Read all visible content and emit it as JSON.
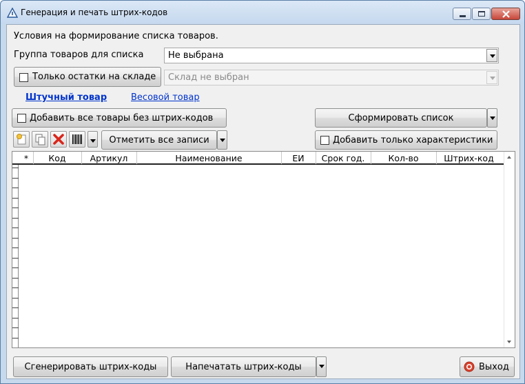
{
  "window": {
    "title": "Генерация и печать штрих-кодов"
  },
  "filters": {
    "conditions_label": "Условия на формирование списка товаров.",
    "group_label": "Группа товаров для списка",
    "group_value": "Не выбрана",
    "stock_only_label": "Только остатки на складе",
    "stock_only_checked": false,
    "warehouse_placeholder": "Склад не выбран"
  },
  "tabs": {
    "piece": "Штучный товар",
    "weight": "Весовой товар",
    "active": "piece"
  },
  "options": {
    "add_without_barcodes_label": "Добавить все товары без штрих-кодов",
    "add_without_barcodes_checked": false,
    "form_list_label": "Сформировать список",
    "mark_all_label": "Отметить все записи",
    "add_characteristics_label": "Добавить только характеристики",
    "add_characteristics_checked": false
  },
  "toolbar": {
    "icons": [
      "new-record-icon",
      "copy-record-icon",
      "delete-record-icon",
      "barcode-icon"
    ]
  },
  "grid": {
    "columns": [
      "*",
      "Код",
      "Артикул",
      "Наименование",
      "ЕИ",
      "Срок год.",
      "Кол-во",
      "Штрих-код"
    ],
    "rows": []
  },
  "footer": {
    "generate_label": "Сгенерировать штрих-коды",
    "print_label": "Напечатать штрих-коды",
    "exit_label": "Выход"
  },
  "colors": {
    "link": "#0033cc",
    "exit_icon": "#d9432f",
    "delete_icon": "#d9261c"
  }
}
